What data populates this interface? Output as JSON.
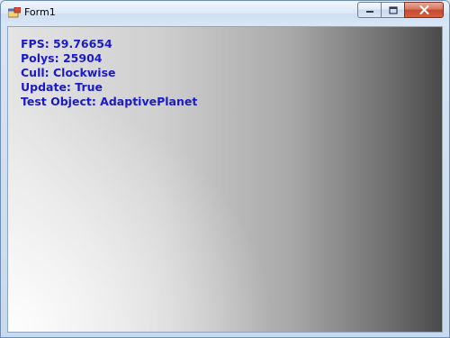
{
  "window": {
    "title": "Form1"
  },
  "caption_buttons": {
    "minimize_icon": "minimize-icon",
    "maximize_icon": "maximize-icon",
    "close_icon": "close-icon"
  },
  "overlay": {
    "fps": "FPS: 59.76654",
    "polys": "Polys: 25904",
    "cull": "Cull: Clockwise",
    "update": "Update: True",
    "test_object": "Test Object: AdaptivePlanet"
  },
  "colors": {
    "overlay_text": "#1a1ac8",
    "close_button": "#c74a2e"
  }
}
